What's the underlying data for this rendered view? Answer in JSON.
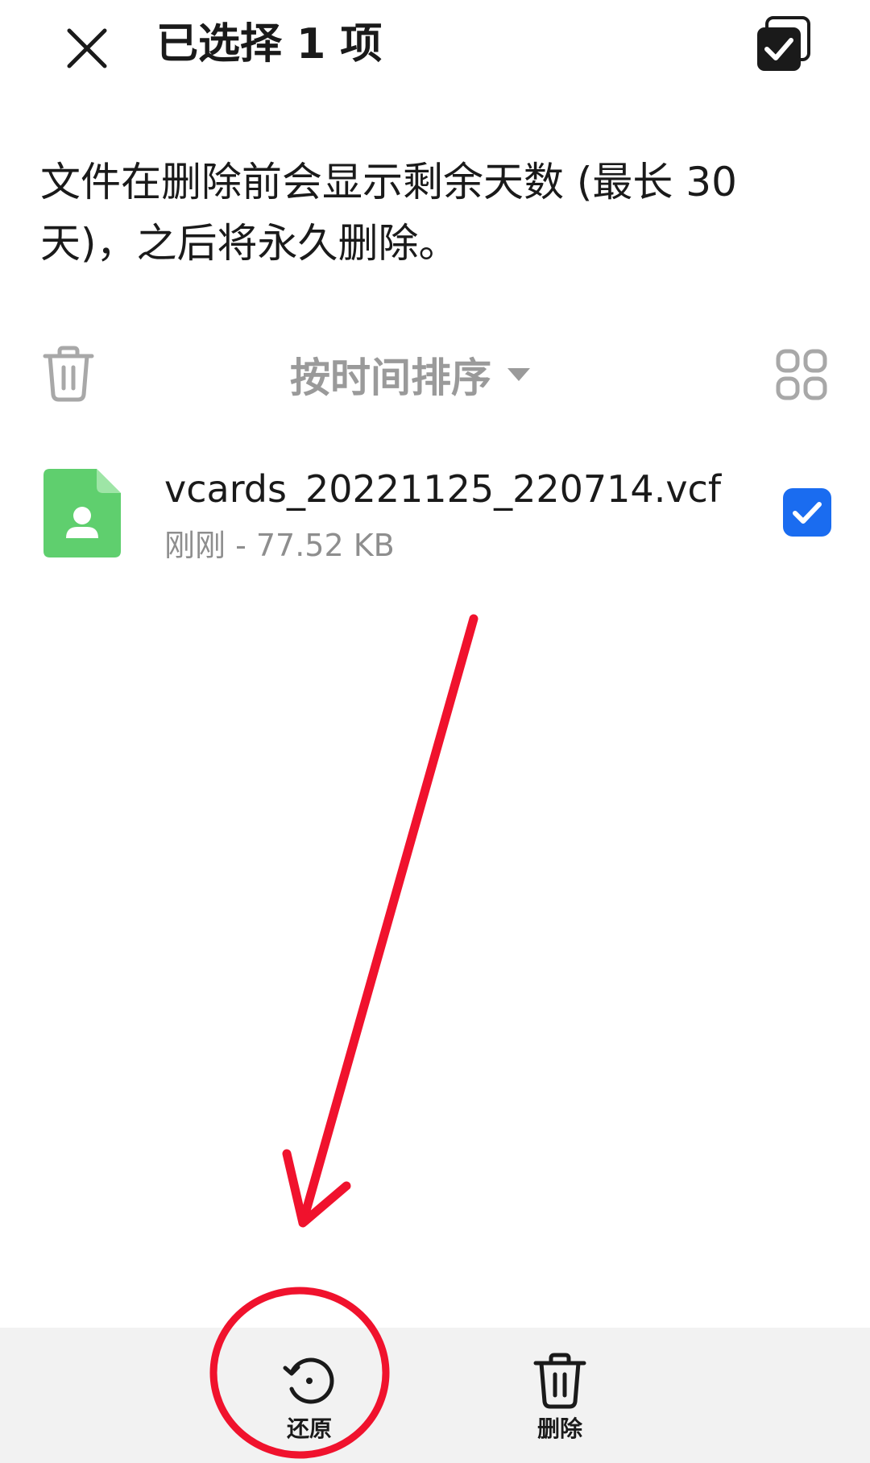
{
  "header": {
    "title": "已选择 1 项",
    "close_icon": "close-icon",
    "select_all_icon": "select-all-icon"
  },
  "info": {
    "text": "文件在删除前会显示剩余天数 (最长 30 天)，之后将永久删除。"
  },
  "toolbar": {
    "sort_label": "按时间排序",
    "delete_icon": "trash-icon",
    "view_icon": "grid-view-icon"
  },
  "files": [
    {
      "name": "vcards_20221125_220714.vcf",
      "meta": "刚刚 - 77.52 KB",
      "icon": "contact-file-icon",
      "checked": true
    }
  ],
  "bottom_bar": {
    "restore_label": "还原",
    "delete_label": "删除"
  },
  "colors": {
    "accent": "#1a6cf0",
    "file_icon_green": "#5fcf6e",
    "annotation_red": "#f0122d",
    "bottom_bar_bg": "#f2f2f2",
    "secondary_text": "#8e8e8e"
  }
}
